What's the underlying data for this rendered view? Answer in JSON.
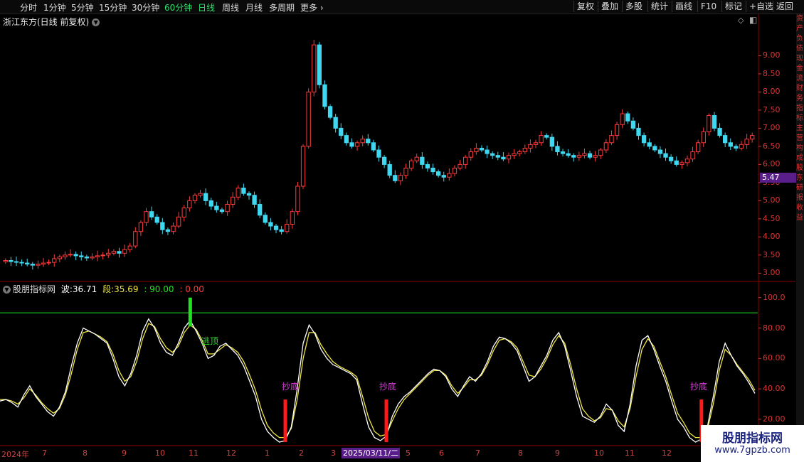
{
  "toolbar": {
    "periods": [
      "分时",
      "1分钟",
      "5分钟",
      "15分钟",
      "30分钟",
      "60分钟",
      "日线",
      "周线",
      "月线",
      "多周期",
      "更多"
    ],
    "active_period": "日线",
    "right_buttons": [
      "复权",
      "叠加",
      "多股",
      "统计",
      "画线",
      "F10",
      "标记",
      "+自选",
      "返回"
    ]
  },
  "chart_header": {
    "title": "浙江东方(日线 前复权)"
  },
  "price_axis": {
    "ticks": [
      "9.00",
      "8.50",
      "8.00",
      "7.50",
      "7.00",
      "6.50",
      "6.00",
      "5.50",
      "5.00",
      "4.50",
      "4.00",
      "3.50",
      "3.00"
    ],
    "current_price": "5.47"
  },
  "indicator": {
    "name": "股朋指标网",
    "wave_label": "波:",
    "wave_value": "36.71",
    "seg_label": "段:",
    "seg_value": "35.69",
    "level_high": ": 90.00",
    "level_low": ": 0.00",
    "axis_ticks": [
      "100.0",
      "80.00",
      "60.00",
      "40.00",
      "20.00"
    ],
    "annotations": {
      "escape": "逃顶",
      "bottom": "抄底"
    }
  },
  "date_axis": {
    "labels": [
      "2024年",
      "7",
      "8",
      "9",
      "10",
      "11",
      "12",
      "1",
      "2",
      "3",
      "5",
      "6",
      "7",
      "8",
      "9",
      "10",
      "11",
      "12"
    ],
    "cursor_date": "2025/03/11/二"
  },
  "side_panel": {
    "text": "资产负债现金流财务指标主营构成股东研报收益"
  },
  "watermark": {
    "title": "股朋指标网",
    "url": "www.7gpzb.com"
  },
  "colors": {
    "up": "#ff3b3b",
    "down": "#3fd8f0",
    "wave": "#ffffff",
    "seg": "#f0e640",
    "grid": "#8b0000",
    "escape": "#22e022",
    "bottom": "#ff1a1a",
    "label_bottom": "#e040e0"
  },
  "chart_data": [
    {
      "type": "candlestick",
      "title": "浙江东方(日线 前复权)",
      "ylim": [
        3.0,
        9.0
      ],
      "x_start": "2024年",
      "close_series": [
        3.35,
        3.32,
        3.3,
        3.28,
        3.25,
        3.22,
        3.25,
        3.28,
        3.3,
        3.4,
        3.45,
        3.5,
        3.52,
        3.48,
        3.45,
        3.42,
        3.45,
        3.48,
        3.5,
        3.55,
        3.6,
        3.55,
        3.65,
        3.75,
        4.15,
        4.4,
        4.7,
        4.55,
        4.4,
        4.2,
        4.15,
        4.3,
        4.55,
        4.8,
        5.0,
        5.15,
        5.2,
        5.0,
        4.85,
        4.75,
        4.7,
        4.9,
        5.1,
        5.35,
        5.2,
        5.15,
        4.9,
        4.6,
        4.4,
        4.3,
        4.2,
        4.15,
        4.35,
        4.7,
        5.4,
        6.5,
        8.0,
        9.3,
        8.2,
        7.6,
        7.3,
        7.0,
        6.8,
        6.6,
        6.5,
        6.6,
        6.7,
        6.6,
        6.4,
        6.2,
        6.0,
        5.7,
        5.55,
        5.7,
        5.9,
        6.1,
        6.2,
        6.0,
        5.9,
        5.8,
        5.7,
        5.65,
        5.75,
        5.9,
        6.0,
        6.2,
        6.35,
        6.45,
        6.4,
        6.3,
        6.25,
        6.2,
        6.15,
        6.25,
        6.3,
        6.35,
        6.45,
        6.55,
        6.6,
        6.8,
        6.75,
        6.5,
        6.35,
        6.3,
        6.25,
        6.2,
        6.25,
        6.3,
        6.2,
        6.25,
        6.4,
        6.6,
        6.8,
        7.1,
        7.4,
        7.2,
        7.0,
        6.8,
        6.6,
        6.5,
        6.4,
        6.3,
        6.2,
        6.1,
        6.0,
        6.05,
        6.15,
        6.35,
        6.6,
        6.9,
        7.35,
        7.0,
        6.8,
        6.6,
        6.5,
        6.45,
        6.55,
        6.7,
        6.8
      ]
    },
    {
      "type": "line",
      "title": "股朋指标网",
      "ylim": [
        0,
        100
      ],
      "y_ticks": [
        100,
        80,
        60,
        40,
        20
      ],
      "level_line": 90,
      "series": [
        {
          "name": "波",
          "values": [
            32,
            33,
            31,
            28,
            36,
            42,
            35,
            30,
            25,
            22,
            28,
            38,
            55,
            70,
            80,
            78,
            76,
            73,
            70,
            60,
            48,
            42,
            50,
            62,
            78,
            86,
            80,
            70,
            64,
            62,
            70,
            80,
            85,
            78,
            70,
            60,
            62,
            68,
            70,
            66,
            62,
            55,
            45,
            35,
            20,
            12,
            8,
            5,
            6,
            15,
            40,
            70,
            82,
            76,
            66,
            60,
            56,
            54,
            52,
            50,
            46,
            30,
            15,
            8,
            6,
            9,
            22,
            30,
            35,
            38,
            42,
            46,
            50,
            53,
            52,
            48,
            40,
            35,
            42,
            48,
            45,
            50,
            58,
            68,
            74,
            73,
            70,
            65,
            55,
            45,
            48,
            55,
            62,
            72,
            77,
            68,
            52,
            35,
            22,
            20,
            18,
            22,
            30,
            26,
            16,
            12,
            30,
            55,
            72,
            75,
            66,
            55,
            45,
            32,
            20,
            15,
            8,
            5,
            7,
            15,
            35,
            58,
            70,
            62,
            55,
            50,
            44,
            37
          ],
          "last": 36.71
        },
        {
          "name": "段",
          "values": [
            33,
            33,
            32,
            30,
            34,
            40,
            36,
            31,
            27,
            24,
            27,
            36,
            50,
            66,
            77,
            78,
            76,
            74,
            71,
            63,
            52,
            45,
            48,
            58,
            73,
            83,
            81,
            73,
            67,
            64,
            68,
            77,
            82,
            79,
            72,
            63,
            63,
            66,
            69,
            67,
            64,
            58,
            49,
            39,
            26,
            16,
            11,
            8,
            8,
            14,
            33,
            60,
            77,
            77,
            69,
            63,
            58,
            55,
            53,
            51,
            48,
            35,
            21,
            12,
            9,
            10,
            19,
            27,
            33,
            37,
            41,
            45,
            49,
            52,
            52,
            49,
            42,
            37,
            41,
            46,
            46,
            49,
            56,
            65,
            72,
            73,
            71,
            67,
            58,
            49,
            48,
            53,
            60,
            69,
            75,
            70,
            56,
            40,
            27,
            22,
            19,
            21,
            27,
            26,
            19,
            15,
            27,
            48,
            66,
            73,
            68,
            58,
            48,
            36,
            24,
            18,
            11,
            8,
            8,
            13,
            30,
            52,
            66,
            62,
            56,
            51,
            46,
            39
          ],
          "last": 35.69
        }
      ]
    }
  ]
}
